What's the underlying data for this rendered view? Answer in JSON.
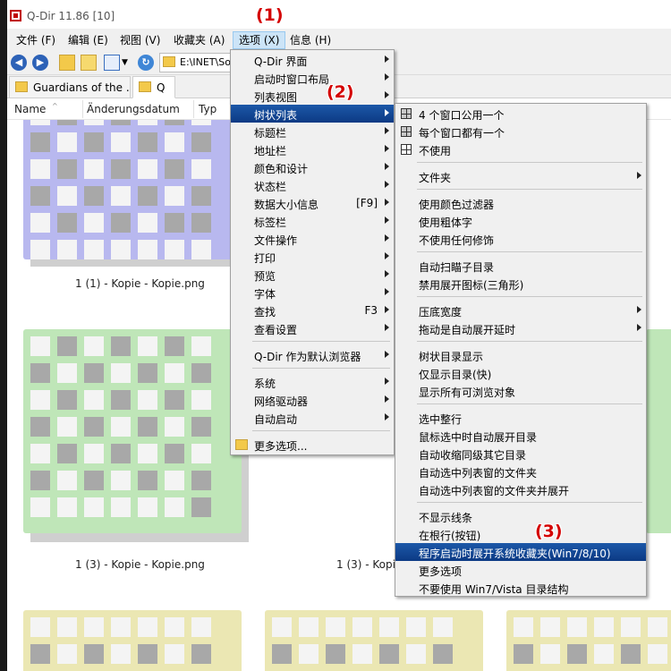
{
  "window": {
    "title": "Q-Dir 11.86 [10]"
  },
  "menubar": {
    "items": [
      "文件 (F)",
      "编辑 (E)",
      "视图 (V)",
      "收藏夹 (A)",
      "选项 (X)",
      "信息 (H)"
    ]
  },
  "toolbar": {
    "address": "E:\\INET\\So",
    "icons": [
      "back-icon",
      "forward-icon",
      "up-folder-icon",
      "new-folder-icon",
      "view-mode-icon",
      "refresh-icon"
    ]
  },
  "tabs": [
    {
      "label": "Guardians of the ..."
    },
    {
      "label": "Q"
    }
  ],
  "columns": [
    "Name",
    "Änderungsdatum",
    "Typ"
  ],
  "thumbnails": [
    {
      "caption": "1 (1) - Kopie - Kopie.png"
    },
    {
      "caption": "1 (3) - Kopie - Kopie.png"
    },
    {
      "caption": "1 (3) - Kopie"
    }
  ],
  "options_menu": {
    "items": [
      {
        "label": "Q-Dir 界面",
        "submenu": true
      },
      {
        "label": "启动时窗口布局",
        "submenu": true
      },
      {
        "label": "列表视图",
        "submenu": true
      },
      {
        "label": "树状列表",
        "submenu": true,
        "highlighted": true
      },
      {
        "label": "标题栏",
        "submenu": true
      },
      {
        "label": "地址栏",
        "submenu": true
      },
      {
        "label": "颜色和设计",
        "submenu": true
      },
      {
        "label": "状态栏",
        "submenu": true
      },
      {
        "label": "数据大小信息",
        "shortcut": "[F9]",
        "submenu": true
      },
      {
        "label": "标签栏",
        "submenu": true
      },
      {
        "label": "文件操作",
        "submenu": true
      },
      {
        "label": "打印",
        "submenu": true
      },
      {
        "label": "预览",
        "submenu": true
      },
      {
        "label": "字体",
        "submenu": true
      },
      {
        "label": "查找",
        "shortcut": "F3",
        "submenu": true
      },
      {
        "label": "查看设置",
        "submenu": true
      },
      {
        "label": "Q-Dir 作为默认浏览器",
        "submenu": true
      },
      {
        "label": "系统",
        "submenu": true
      },
      {
        "label": "网络驱动器",
        "submenu": true
      },
      {
        "label": "自动启动",
        "submenu": true
      },
      {
        "label": "更多选项..."
      }
    ]
  },
  "tree_submenu": {
    "items": [
      {
        "label": "4 个窗口公用一个",
        "icon": "tree-shared-icon"
      },
      {
        "label": "每个窗口都有一个",
        "icon": "tree-each-icon"
      },
      {
        "label": "不使用",
        "icon": "tree-none-icon"
      },
      {
        "label": "文件夹",
        "submenu": true
      },
      {
        "label": "使用颜色过滤器"
      },
      {
        "label": "使用粗体字"
      },
      {
        "label": "不使用任何修饰"
      },
      {
        "label": "自动扫瞄子目录"
      },
      {
        "label": "禁用展开图标(三角形)"
      },
      {
        "label": "压底宽度",
        "submenu": true
      },
      {
        "label": "拖动是自动展开延时",
        "submenu": true
      },
      {
        "label": "树状目录显示"
      },
      {
        "label": "仅显示目录(快)"
      },
      {
        "label": "显示所有可浏览对象"
      },
      {
        "label": "选中整行"
      },
      {
        "label": "鼠标选中时自动展开目录"
      },
      {
        "label": "自动收缩同级其它目录"
      },
      {
        "label": "自动选中列表窗的文件夹"
      },
      {
        "label": "自动选中列表窗的文件夹并展开"
      },
      {
        "label": "不显示线条"
      },
      {
        "label": "在根行(按钮)"
      },
      {
        "label": "程序启动时展开系统收藏夹(Win7/8/10)",
        "highlighted": true
      },
      {
        "label": "更多选项"
      },
      {
        "label": "不要使用 Win7/Vista 目录结构"
      }
    ]
  },
  "annotations": [
    "(1)",
    "(2)",
    "(3)"
  ],
  "colors": {
    "highlight": "#0c3a84",
    "menu_bg": "#f0f0f0",
    "annotation": "#d40000",
    "thumb_purple": "#b8b8ef",
    "thumb_green": "#bfe6b8",
    "thumb_yellow": "#ebe7b3",
    "cell_gray": "#a8a8a8"
  }
}
